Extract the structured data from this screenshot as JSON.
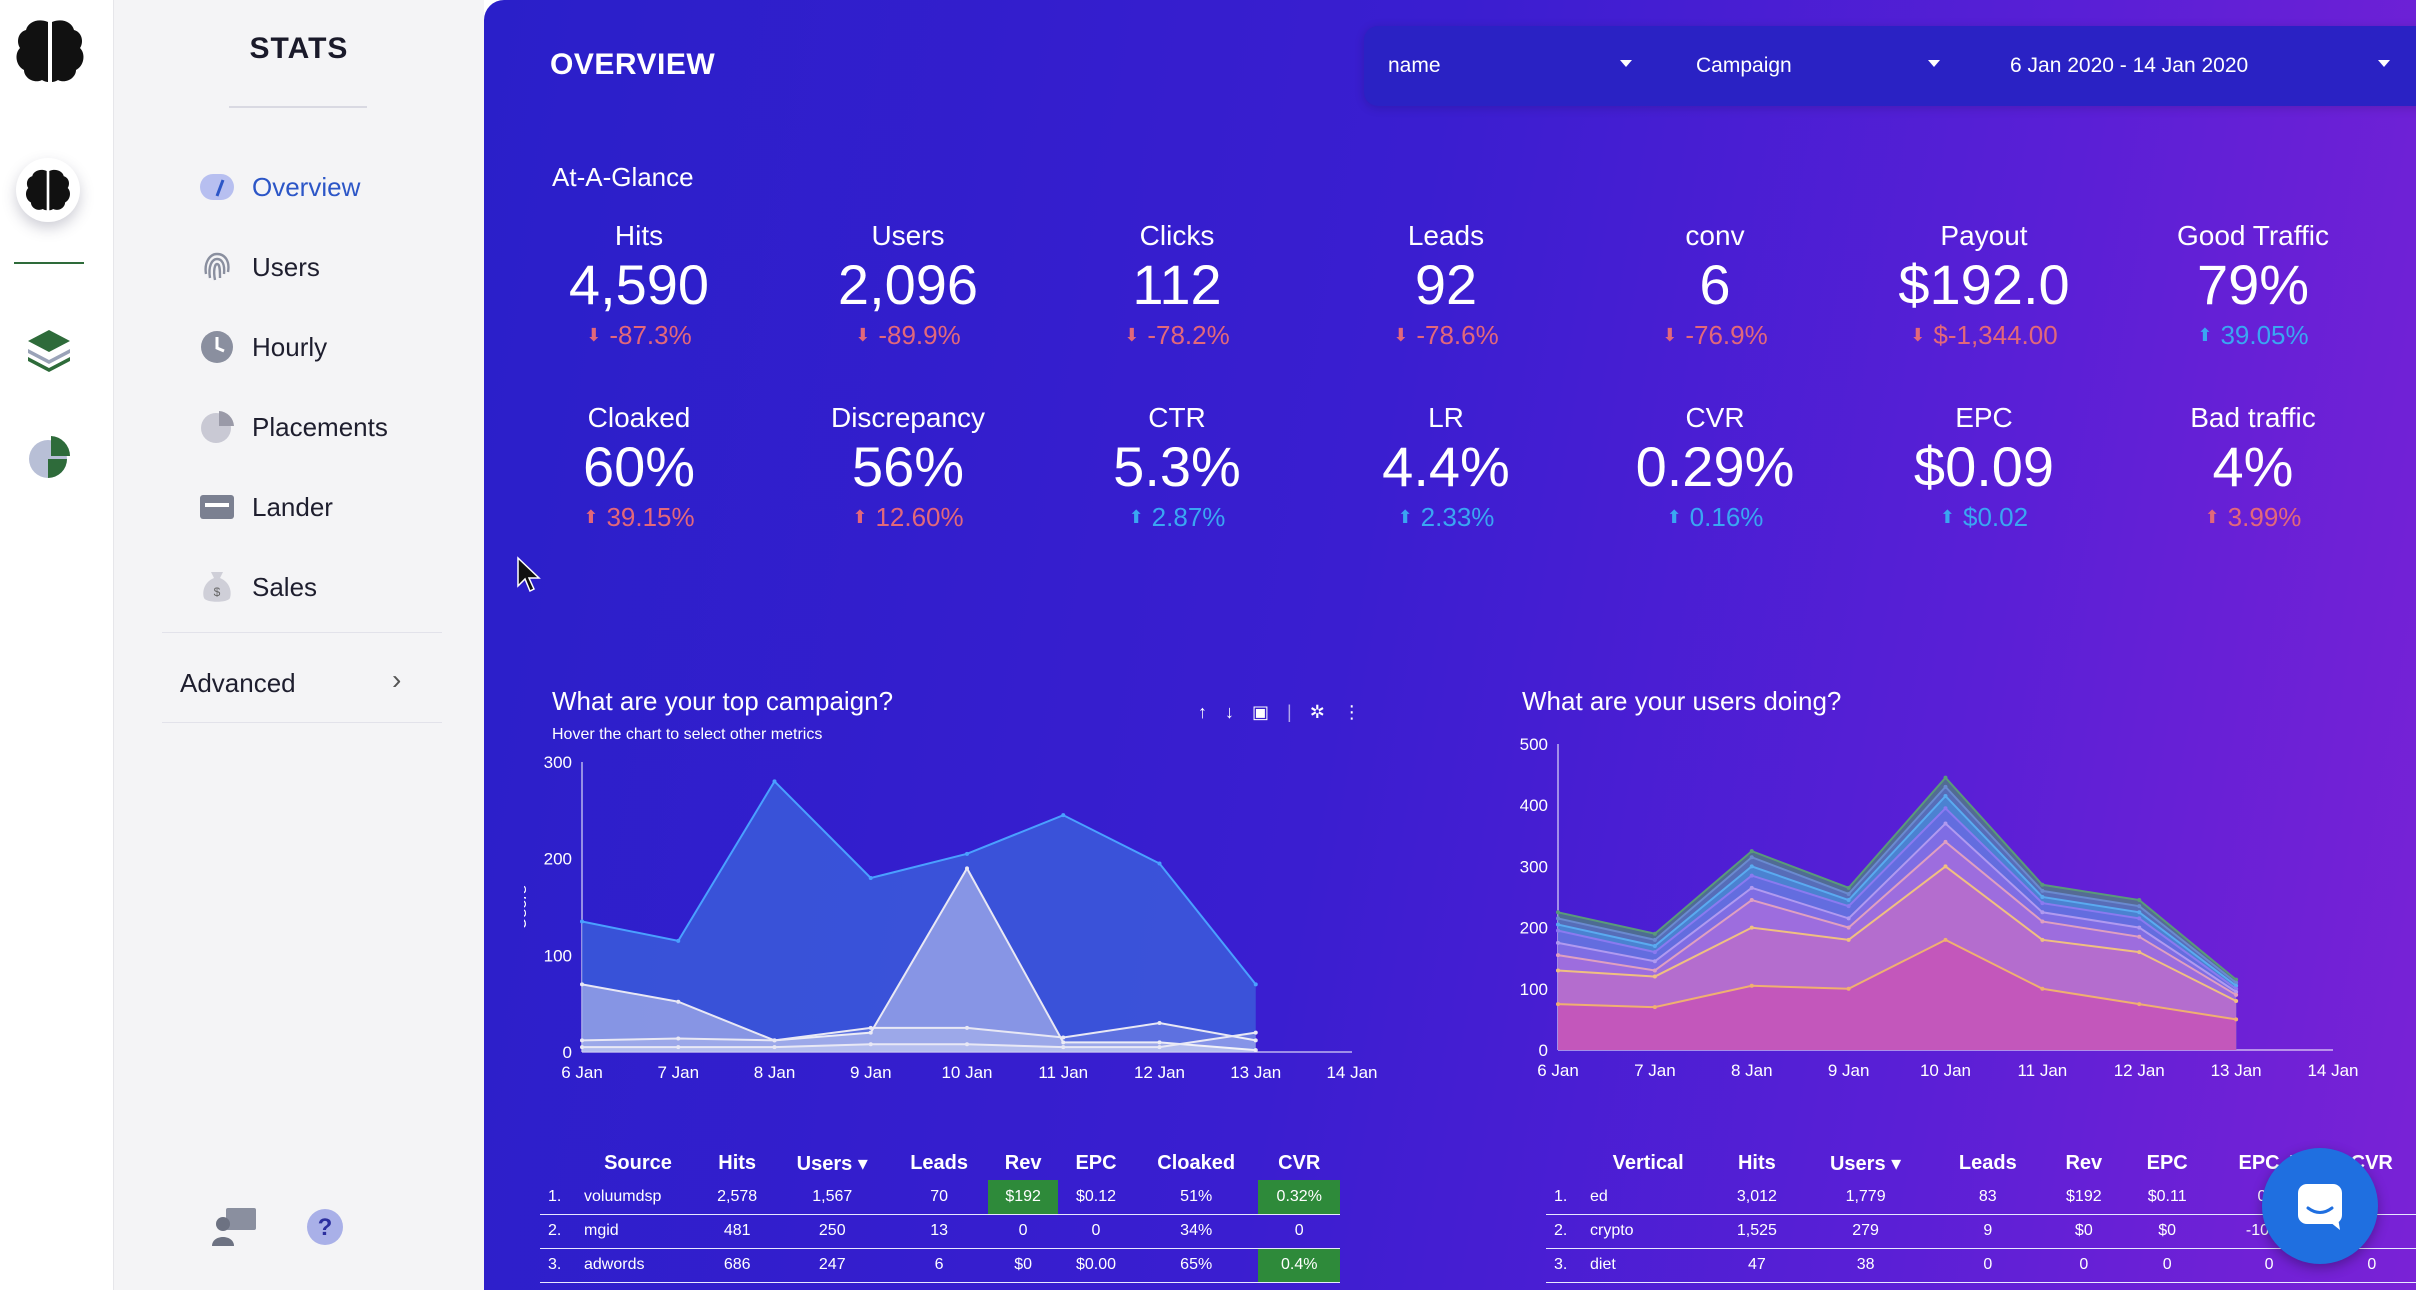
{
  "rail": {
    "icons": [
      "brain-logo",
      "brain-icon",
      "layers-icon",
      "pie-icon"
    ],
    "accent": "#2e6b3a"
  },
  "sidebar": {
    "title": "STATS",
    "items": [
      {
        "label": "Overview",
        "icon": "gauge-icon",
        "active": true
      },
      {
        "label": "Users",
        "icon": "fingerprint-icon"
      },
      {
        "label": "Hourly",
        "icon": "clock-icon"
      },
      {
        "label": "Placements",
        "icon": "pie-icon"
      },
      {
        "label": "Lander",
        "icon": "card-icon"
      },
      {
        "label": "Sales",
        "icon": "money-bag-icon"
      }
    ],
    "advanced": "Advanced"
  },
  "header": {
    "title": "OVERVIEW"
  },
  "filters": {
    "dimension": "name",
    "group": "Campaign",
    "date_range": "6 Jan 2020 - 14 Jan 2020"
  },
  "glance": {
    "title": "At-A-Glance",
    "kpis": [
      {
        "label": "Hits",
        "value": "4,590",
        "change": "-87.3%",
        "dir": "down"
      },
      {
        "label": "Users",
        "value": "2,096",
        "change": "-89.9%",
        "dir": "down"
      },
      {
        "label": "Clicks",
        "value": "112",
        "change": "-78.2%",
        "dir": "down"
      },
      {
        "label": "Leads",
        "value": "92",
        "change": "-78.6%",
        "dir": "down"
      },
      {
        "label": "conv",
        "value": "6",
        "change": "-76.9%",
        "dir": "down"
      },
      {
        "label": "Payout",
        "value": "$192.0",
        "change": "$-1,344.00",
        "dir": "down"
      },
      {
        "label": "Good Traffic",
        "value": "79%",
        "change": "39.05%",
        "dir": "upblue"
      },
      {
        "label": "Cloaked",
        "value": "60%",
        "change": "39.15%",
        "dir": "upred"
      },
      {
        "label": "Discrepancy",
        "value": "56%",
        "change": "12.60%",
        "dir": "upred"
      },
      {
        "label": "CTR",
        "value": "5.3%",
        "change": "2.87%",
        "dir": "upblue"
      },
      {
        "label": "LR",
        "value": "4.4%",
        "change": "2.33%",
        "dir": "upblue"
      },
      {
        "label": "CVR",
        "value": "0.29%",
        "change": "0.16%",
        "dir": "upblue"
      },
      {
        "label": "EPC",
        "value": "$0.09",
        "change": "$0.02",
        "dir": "upblue"
      },
      {
        "label": "Bad traffic",
        "value": "4%",
        "change": "3.99%",
        "dir": "upred"
      }
    ]
  },
  "chart1": {
    "title": "What are your top campaign?",
    "subtitle": "Hover the chart to select other metrics",
    "tools": [
      "arrow-up-icon",
      "arrow-down-icon",
      "chart-icon",
      "sparkle-icon",
      "more-icon"
    ]
  },
  "chart2": {
    "title": "What are your users doing?"
  },
  "chart_data": [
    {
      "type": "area",
      "title": "What are your top campaign?",
      "ylabel": "Users",
      "categories": [
        "6 Jan",
        "7 Jan",
        "8 Jan",
        "9 Jan",
        "10 Jan",
        "11 Jan",
        "12 Jan",
        "13 Jan",
        "14 Jan"
      ],
      "yticks": [
        "0",
        "100",
        "200",
        "300"
      ],
      "ylim": [
        0,
        300
      ],
      "series": [
        {
          "values": [
            135,
            115,
            280,
            180,
            205,
            245,
            195,
            70
          ]
        },
        {
          "values": [
            70,
            52,
            12,
            20,
            190,
            10,
            10,
            2
          ]
        },
        {
          "values": [
            12,
            14,
            12,
            25,
            25,
            15,
            30,
            12
          ]
        },
        {
          "values": [
            5,
            5,
            5,
            8,
            8,
            5,
            5,
            20
          ]
        }
      ]
    },
    {
      "type": "area",
      "title": "What are your users doing?",
      "categories": [
        "6 Jan",
        "7 Jan",
        "8 Jan",
        "9 Jan",
        "10 Jan",
        "11 Jan",
        "12 Jan",
        "13 Jan",
        "14 Jan"
      ],
      "yticks": [
        "0",
        "100",
        "200",
        "300",
        "400",
        "500"
      ],
      "ylim": [
        0,
        500
      ],
      "series": [
        {
          "values": [
            225,
            190,
            325,
            265,
            445,
            270,
            245,
            115
          ]
        },
        {
          "values": [
            215,
            180,
            315,
            255,
            430,
            260,
            235,
            110
          ]
        },
        {
          "values": [
            205,
            170,
            300,
            245,
            415,
            250,
            225,
            105
          ]
        },
        {
          "values": [
            195,
            160,
            285,
            235,
            395,
            240,
            215,
            100
          ]
        },
        {
          "values": [
            175,
            145,
            265,
            215,
            370,
            225,
            200,
            95
          ]
        },
        {
          "values": [
            155,
            130,
            245,
            200,
            340,
            210,
            185,
            90
          ]
        },
        {
          "values": [
            130,
            120,
            200,
            180,
            300,
            180,
            160,
            80
          ]
        },
        {
          "values": [
            75,
            70,
            105,
            100,
            180,
            100,
            75,
            50
          ]
        }
      ]
    }
  ],
  "colors": {
    "green_cell": "#2e8a3a",
    "down": "#e2687a",
    "up_blue": "#3aa6f2",
    "chat": "#1f6fe0"
  },
  "table1": {
    "headers": [
      "Source",
      "Hits",
      "Users",
      "Leads",
      "Rev",
      "EPC",
      "Cloaked",
      "CVR"
    ],
    "rows": [
      {
        "idx": "1.",
        "cells": [
          "voluumdsp",
          "2,578",
          "1,567",
          "70",
          "$192",
          "$0.12",
          "51%",
          "0.32%"
        ]
      },
      {
        "idx": "2.",
        "cells": [
          "mgid",
          "481",
          "250",
          "13",
          "0",
          "0",
          "34%",
          "0"
        ]
      },
      {
        "idx": "3.",
        "cells": [
          "adwords",
          "686",
          "247",
          "6",
          "$0",
          "$0.00",
          "65%",
          "0.4%"
        ]
      }
    ]
  },
  "table2": {
    "headers": [
      "Vertical",
      "Hits",
      "Users",
      "Leads",
      "Rev",
      "EPC",
      "EPC Δ",
      "CVR"
    ],
    "rows": [
      {
        "idx": "1.",
        "cells": [
          "ed",
          "3,012",
          "1,779",
          "83",
          "$192",
          "$0.11",
          "0%",
          ""
        ]
      },
      {
        "idx": "2.",
        "cells": [
          "crypto",
          "1,525",
          "279",
          "9",
          "$0",
          "$0",
          "-100%",
          ""
        ]
      },
      {
        "idx": "3.",
        "cells": [
          "diet",
          "47",
          "38",
          "0",
          "0",
          "0",
          "0",
          "0"
        ]
      }
    ]
  }
}
